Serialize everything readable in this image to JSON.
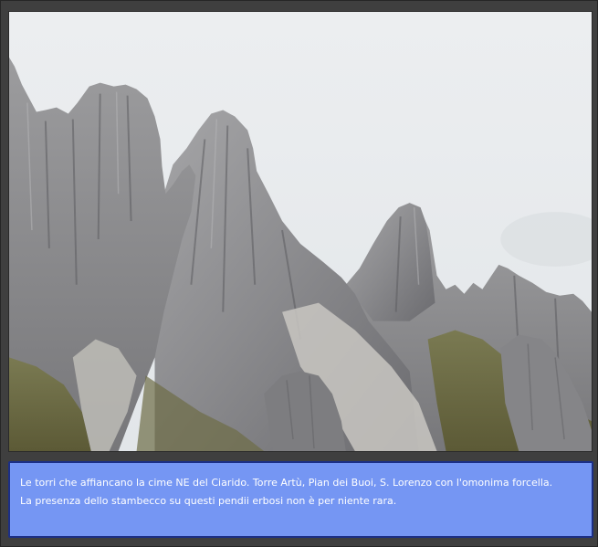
{
  "photo": {
    "subject": "mountain-peaks-icon"
  },
  "caption": {
    "line1": "Le torri che affiancano la cime NE del Ciarido. Torre Artù, Pian dei Buoi, S. Lorenzo con l'omonima forcella.",
    "line2": "La presenza dello stambecco su questi pendii erbosi non è per niente rara."
  },
  "colors": {
    "frame": "#3f3f3f",
    "caption_bg": "#7596f3",
    "caption_border": "#1c2f86",
    "caption_text": "#ffffff",
    "sky": "#e9ecee",
    "rock": "#8d8d8f"
  }
}
